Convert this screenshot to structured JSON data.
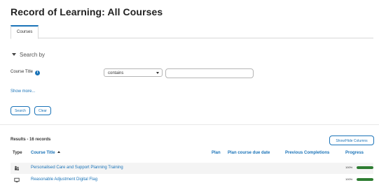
{
  "page": {
    "title": "Record of Learning: All Courses"
  },
  "tabs": [
    {
      "label": "Courses",
      "active": true
    }
  ],
  "search": {
    "toggle_label": "Search by",
    "field_label": "Course Title",
    "operator_selected": "contains",
    "value": "",
    "show_more_label": "Show more...",
    "search_button": "Search",
    "clear_button": "Clear"
  },
  "results": {
    "count_label": "Results - 16 records",
    "show_hide_button": "Show/Hide Columns",
    "columns": {
      "type": "Type",
      "course_title": "Course Title",
      "plan": "Plan",
      "plan_due": "Plan course due date",
      "previous": "Previous Completions",
      "progress": "Progress"
    },
    "rows": [
      {
        "type_icon": "group-icon",
        "title": "Personalised Care and Support Planning Training",
        "progress_label": "100%",
        "progress": 1.0
      },
      {
        "type_icon": "monitor-icon",
        "title": "Reasonable Adjustment Digital Flag",
        "progress_label": "100%",
        "progress": 1.0
      }
    ]
  },
  "colors": {
    "accent": "#1a73b8",
    "progress": "#2e7d32"
  }
}
